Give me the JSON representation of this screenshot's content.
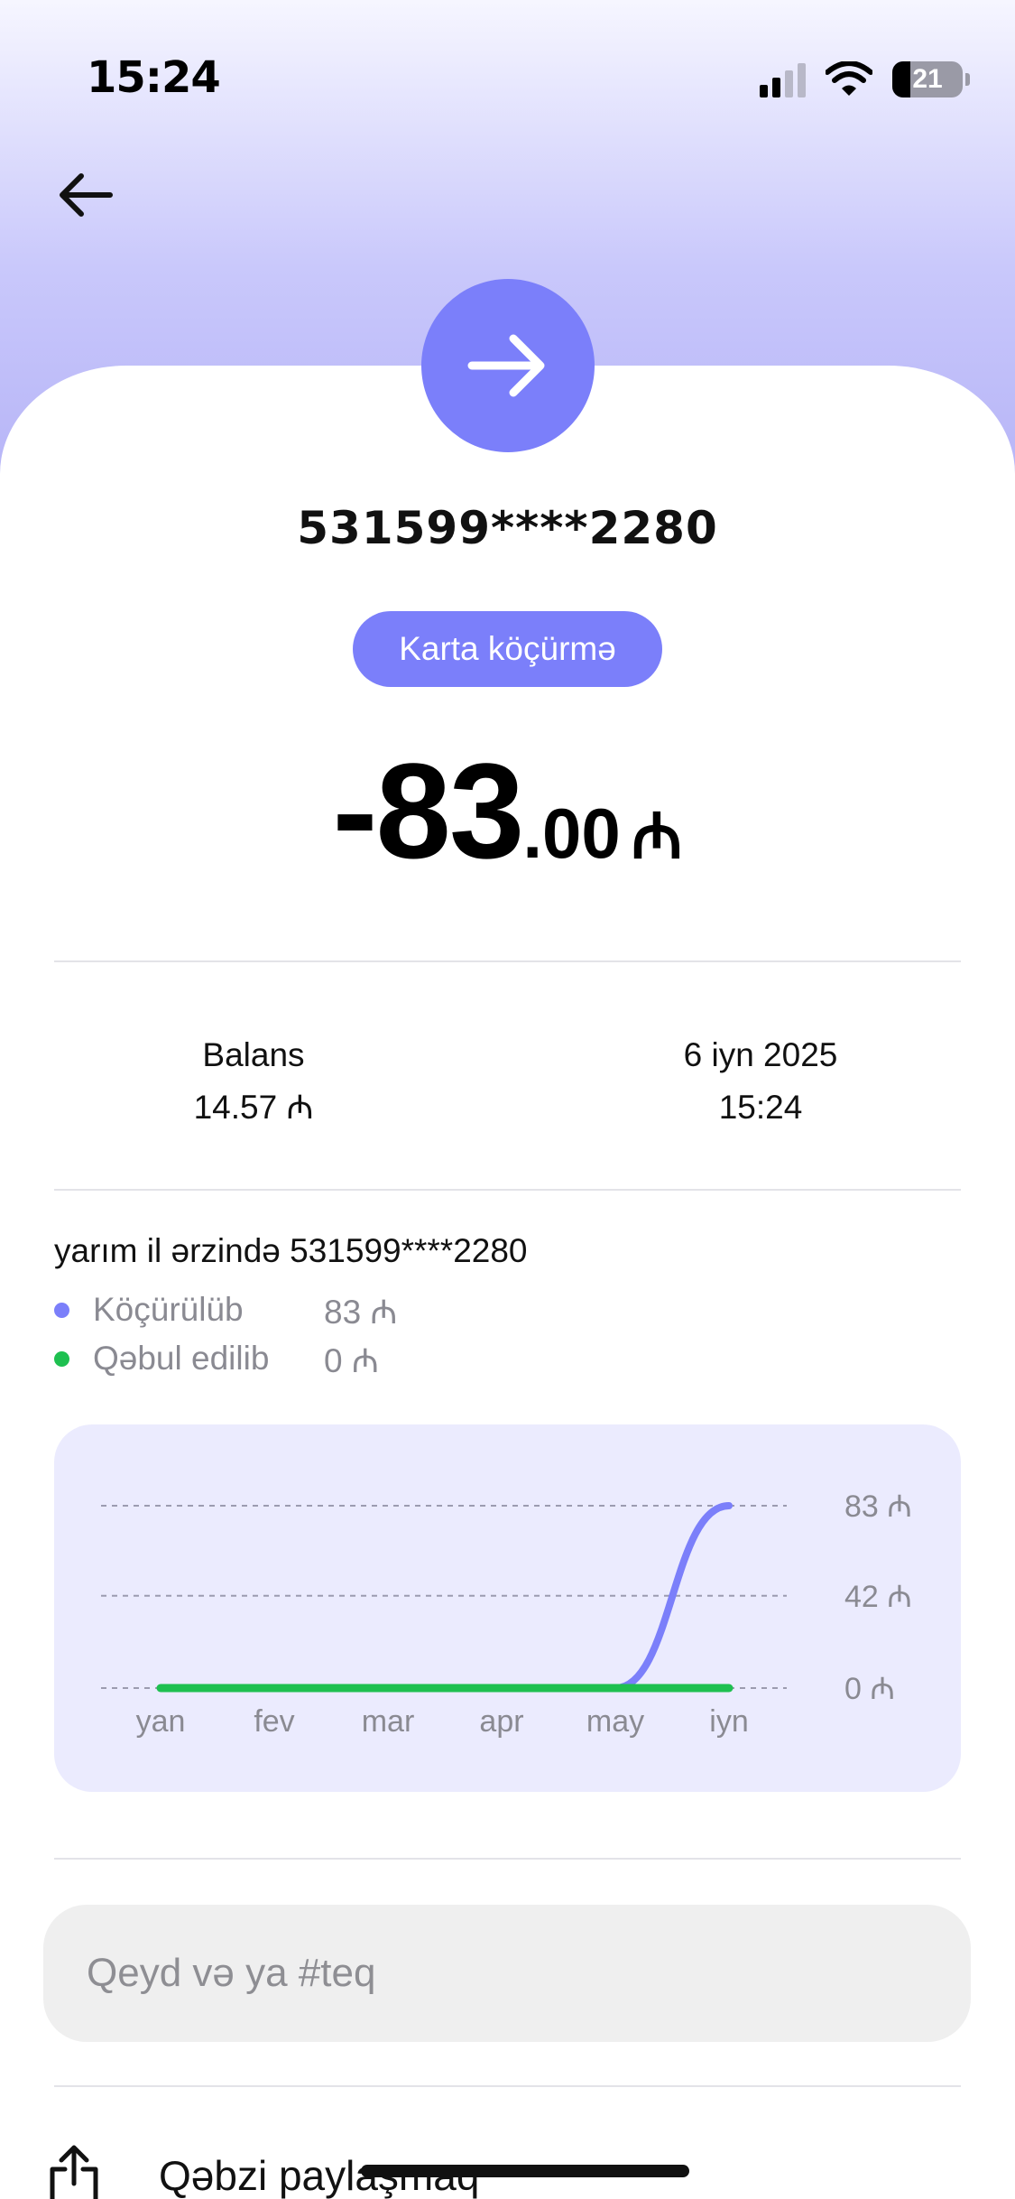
{
  "status_bar": {
    "time": "15:24",
    "battery": "21"
  },
  "header": {
    "back_icon": "arrow-left-icon"
  },
  "transaction": {
    "icon": "arrow-right-icon",
    "card_number": "531599****2280",
    "type_label": "Karta köçürmə",
    "amount_int": "-83",
    "amount_dec": ".00",
    "currency": "₼"
  },
  "details": {
    "balance_label": "Balans",
    "balance_value": "14.57 ₼",
    "date": "6 iyn 2025",
    "time": "15:24"
  },
  "summary": {
    "title": "yarım il ərzində 531599****2280",
    "legend": [
      {
        "label": "Köçürülüb",
        "value": "83 ₼",
        "color": "#7b7ffa"
      },
      {
        "label": "Qəbul edilib",
        "value": "0 ₼",
        "color": "#1ec050"
      }
    ]
  },
  "chart_data": {
    "type": "line",
    "categories": [
      "yan",
      "fev",
      "mar",
      "apr",
      "may",
      "iyn"
    ],
    "series": [
      {
        "name": "Köçürülüb",
        "values": [
          0,
          0,
          0,
          0,
          0,
          83
        ],
        "color": "#7b7ffa"
      },
      {
        "name": "Qəbul edilib",
        "values": [
          0,
          0,
          0,
          0,
          0,
          0
        ],
        "color": "#1ec050"
      }
    ],
    "y_ticks": [
      "83 ₼",
      "42 ₼",
      "0 ₼"
    ],
    "y_tick_values": [
      83,
      42,
      0
    ],
    "ylim": [
      0,
      83
    ],
    "grid": true
  },
  "note": {
    "placeholder": "Qeyd və ya #teq",
    "value": ""
  },
  "actions": {
    "share_label": "Qəbzi paylaşmaq",
    "share_icon": "share-icon"
  }
}
